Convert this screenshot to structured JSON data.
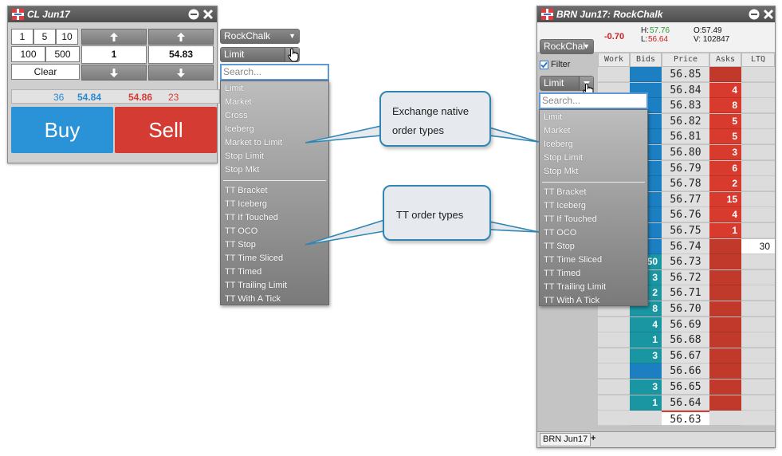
{
  "ticket": {
    "title": "CL Jun17",
    "qty_buttons": [
      "1",
      "5",
      "10",
      "100",
      "500"
    ],
    "clear_label": "Clear",
    "quantity_value": "1",
    "price_value": "54.83",
    "bid_qty": "36",
    "bid_price": "54.84",
    "ask_price": "54.86",
    "ask_qty": "23",
    "buy_label": "Buy",
    "sell_label": "Sell",
    "account_selected": "RockChalk",
    "order_type_selected": "Limit",
    "search_placeholder": "Search...",
    "native_order_types": [
      "Limit",
      "Market",
      "Cross",
      "Iceberg",
      "Market to Limit",
      "Stop Limit",
      "Stop Mkt"
    ],
    "tt_order_types": [
      "TT Bracket",
      "TT Iceberg",
      "TT If Touched",
      "TT OCO",
      "TT Stop",
      "TT Time Sliced",
      "TT Timed",
      "TT Trailing Limit",
      "TT With A Tick"
    ]
  },
  "callouts": {
    "native_line1": "Exchange native",
    "native_line2": "order types",
    "tt": "TT order types"
  },
  "ladder": {
    "title": "BRN Jun17: RockChalk",
    "net_change": "-0.70",
    "high_label": "H:",
    "high": "57.76",
    "low_label": "L:",
    "low": "56.64",
    "open": "O:57.49",
    "volume": "V: 102847",
    "account_selected": "RockChal",
    "filter_label": "Filter",
    "filter_checked": true,
    "order_type_selected": "Limit",
    "search_placeholder": "Search...",
    "native_order_types": [
      "Limit",
      "Market",
      "Iceberg",
      "Stop Limit",
      "Stop Mkt"
    ],
    "tt_order_types": [
      "TT Bracket",
      "TT Iceberg",
      "TT If Touched",
      "TT OCO",
      "TT Stop",
      "TT Time Sliced",
      "TT Timed",
      "TT Trailing Limit",
      "TT With A Tick"
    ],
    "columns": [
      "Work",
      "Bids",
      "Price",
      "Asks",
      "LTQ"
    ],
    "rows": [
      {
        "price": "56.85",
        "bid": "",
        "ask": "",
        "ltq": ""
      },
      {
        "price": "56.84",
        "bid": "",
        "ask": "4",
        "ltq": ""
      },
      {
        "price": "56.83",
        "bid": "",
        "ask": "8",
        "ltq": ""
      },
      {
        "price": "56.82",
        "bid": "",
        "ask": "5",
        "ltq": ""
      },
      {
        "price": "56.81",
        "bid": "",
        "ask": "5",
        "ltq": ""
      },
      {
        "price": "56.80",
        "bid": "",
        "ask": "3",
        "ltq": ""
      },
      {
        "price": "56.79",
        "bid": "",
        "ask": "6",
        "ltq": ""
      },
      {
        "price": "56.78",
        "bid": "",
        "ask": "2",
        "ltq": ""
      },
      {
        "price": "56.77",
        "bid": "",
        "ask": "15",
        "ltq": ""
      },
      {
        "price": "56.76",
        "bid": "",
        "ask": "4",
        "ltq": ""
      },
      {
        "price": "56.75",
        "bid": "",
        "ask": "1",
        "ltq": ""
      },
      {
        "price": "56.74",
        "bid": "",
        "ask": "",
        "ltq": "30"
      },
      {
        "price": "56.73",
        "bid": "50",
        "ask": "",
        "ltq": ""
      },
      {
        "price": "56.72",
        "bid": "3",
        "ask": "",
        "ltq": ""
      },
      {
        "price": "56.71",
        "bid": "2",
        "ask": "",
        "ltq": ""
      },
      {
        "price": "56.70",
        "bid": "8",
        "ask": "",
        "ltq": ""
      },
      {
        "price": "56.69",
        "bid": "4",
        "ask": "",
        "ltq": ""
      },
      {
        "price": "56.68",
        "bid": "1",
        "ask": "",
        "ltq": ""
      },
      {
        "price": "56.67",
        "bid": "3",
        "ask": "",
        "ltq": ""
      },
      {
        "price": "56.66",
        "bid": "",
        "ask": "",
        "ltq": ""
      },
      {
        "price": "56.65",
        "bid": "3",
        "ask": "",
        "ltq": ""
      },
      {
        "price": "56.64",
        "bid": "1",
        "ask": "",
        "ltq": ""
      },
      {
        "price": "56.63",
        "bid": "",
        "ask": "",
        "ltq": ""
      }
    ],
    "tab_label": "BRN Jun17",
    "add_tab_label": "+"
  },
  "colors": {
    "buy": "#2a92d6",
    "sell": "#d43b33",
    "bid_blue": "#1b7fc1",
    "bid_teal": "#1a96a3",
    "ask_red": "#c0392b",
    "ask_cell": "#d83a2d",
    "positive": "#2c9a2c",
    "negative": "#d02020",
    "callout_border": "#2f86b2"
  }
}
